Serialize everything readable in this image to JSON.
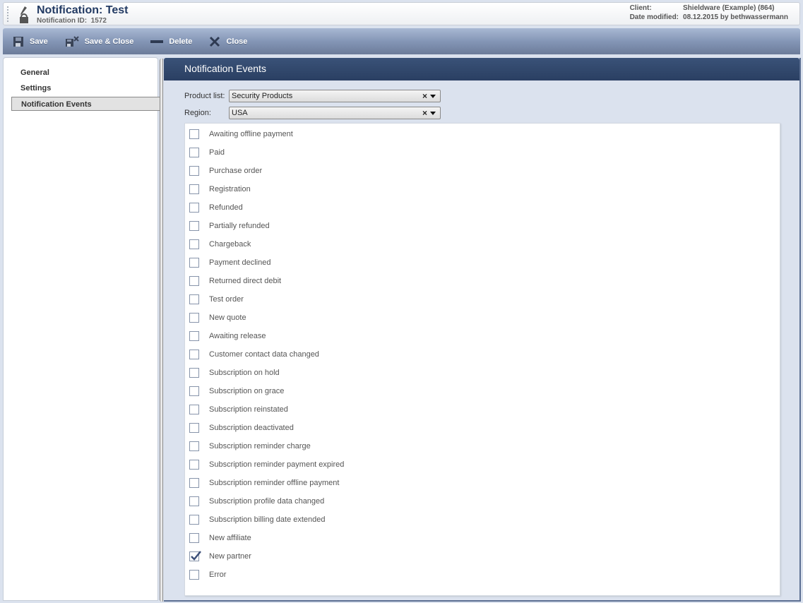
{
  "header": {
    "title": "Notification: Test",
    "subtitle_label": "Notification ID:",
    "notification_id": "1572",
    "client_label": "Client:",
    "client_value": "Shieldware (Example) (864)",
    "modified_label": "Date modified:",
    "modified_value": "08.12.2015 by bethwassermann"
  },
  "toolbar": {
    "save_label": "Save",
    "save_close_label": "Save & Close",
    "delete_label": "Delete",
    "close_label": "Close"
  },
  "nav": {
    "items": [
      {
        "label": "General",
        "active": false
      },
      {
        "label": "Settings",
        "active": false
      },
      {
        "label": "Notification Events",
        "active": true
      }
    ]
  },
  "main": {
    "heading": "Notification Events",
    "product_list_label": "Product list:",
    "product_list_value": "Security Products",
    "region_label": "Region:",
    "region_value": "USA",
    "events": [
      {
        "label": "Awaiting offline payment",
        "checked": false
      },
      {
        "label": "Paid",
        "checked": false
      },
      {
        "label": "Purchase order",
        "checked": false
      },
      {
        "label": "Registration",
        "checked": false
      },
      {
        "label": "Refunded",
        "checked": false
      },
      {
        "label": "Partially refunded",
        "checked": false
      },
      {
        "label": "Chargeback",
        "checked": false
      },
      {
        "label": "Payment declined",
        "checked": false
      },
      {
        "label": "Returned direct debit",
        "checked": false
      },
      {
        "label": "Test order",
        "checked": false
      },
      {
        "label": "New quote",
        "checked": false
      },
      {
        "label": "Awaiting release",
        "checked": false
      },
      {
        "label": "Customer contact data changed",
        "checked": false
      },
      {
        "label": "Subscription on hold",
        "checked": false
      },
      {
        "label": "Subscription on grace",
        "checked": false
      },
      {
        "label": "Subscription reinstated",
        "checked": false
      },
      {
        "label": "Subscription deactivated",
        "checked": false
      },
      {
        "label": "Subscription reminder charge",
        "checked": false
      },
      {
        "label": "Subscription reminder payment expired",
        "checked": false
      },
      {
        "label": "Subscription reminder offline payment",
        "checked": false
      },
      {
        "label": "Subscription profile data changed",
        "checked": false
      },
      {
        "label": "Subscription billing date extended",
        "checked": false
      },
      {
        "label": "New affiliate",
        "checked": false
      },
      {
        "label": "New partner",
        "checked": true
      },
      {
        "label": "Error",
        "checked": false
      }
    ]
  }
}
